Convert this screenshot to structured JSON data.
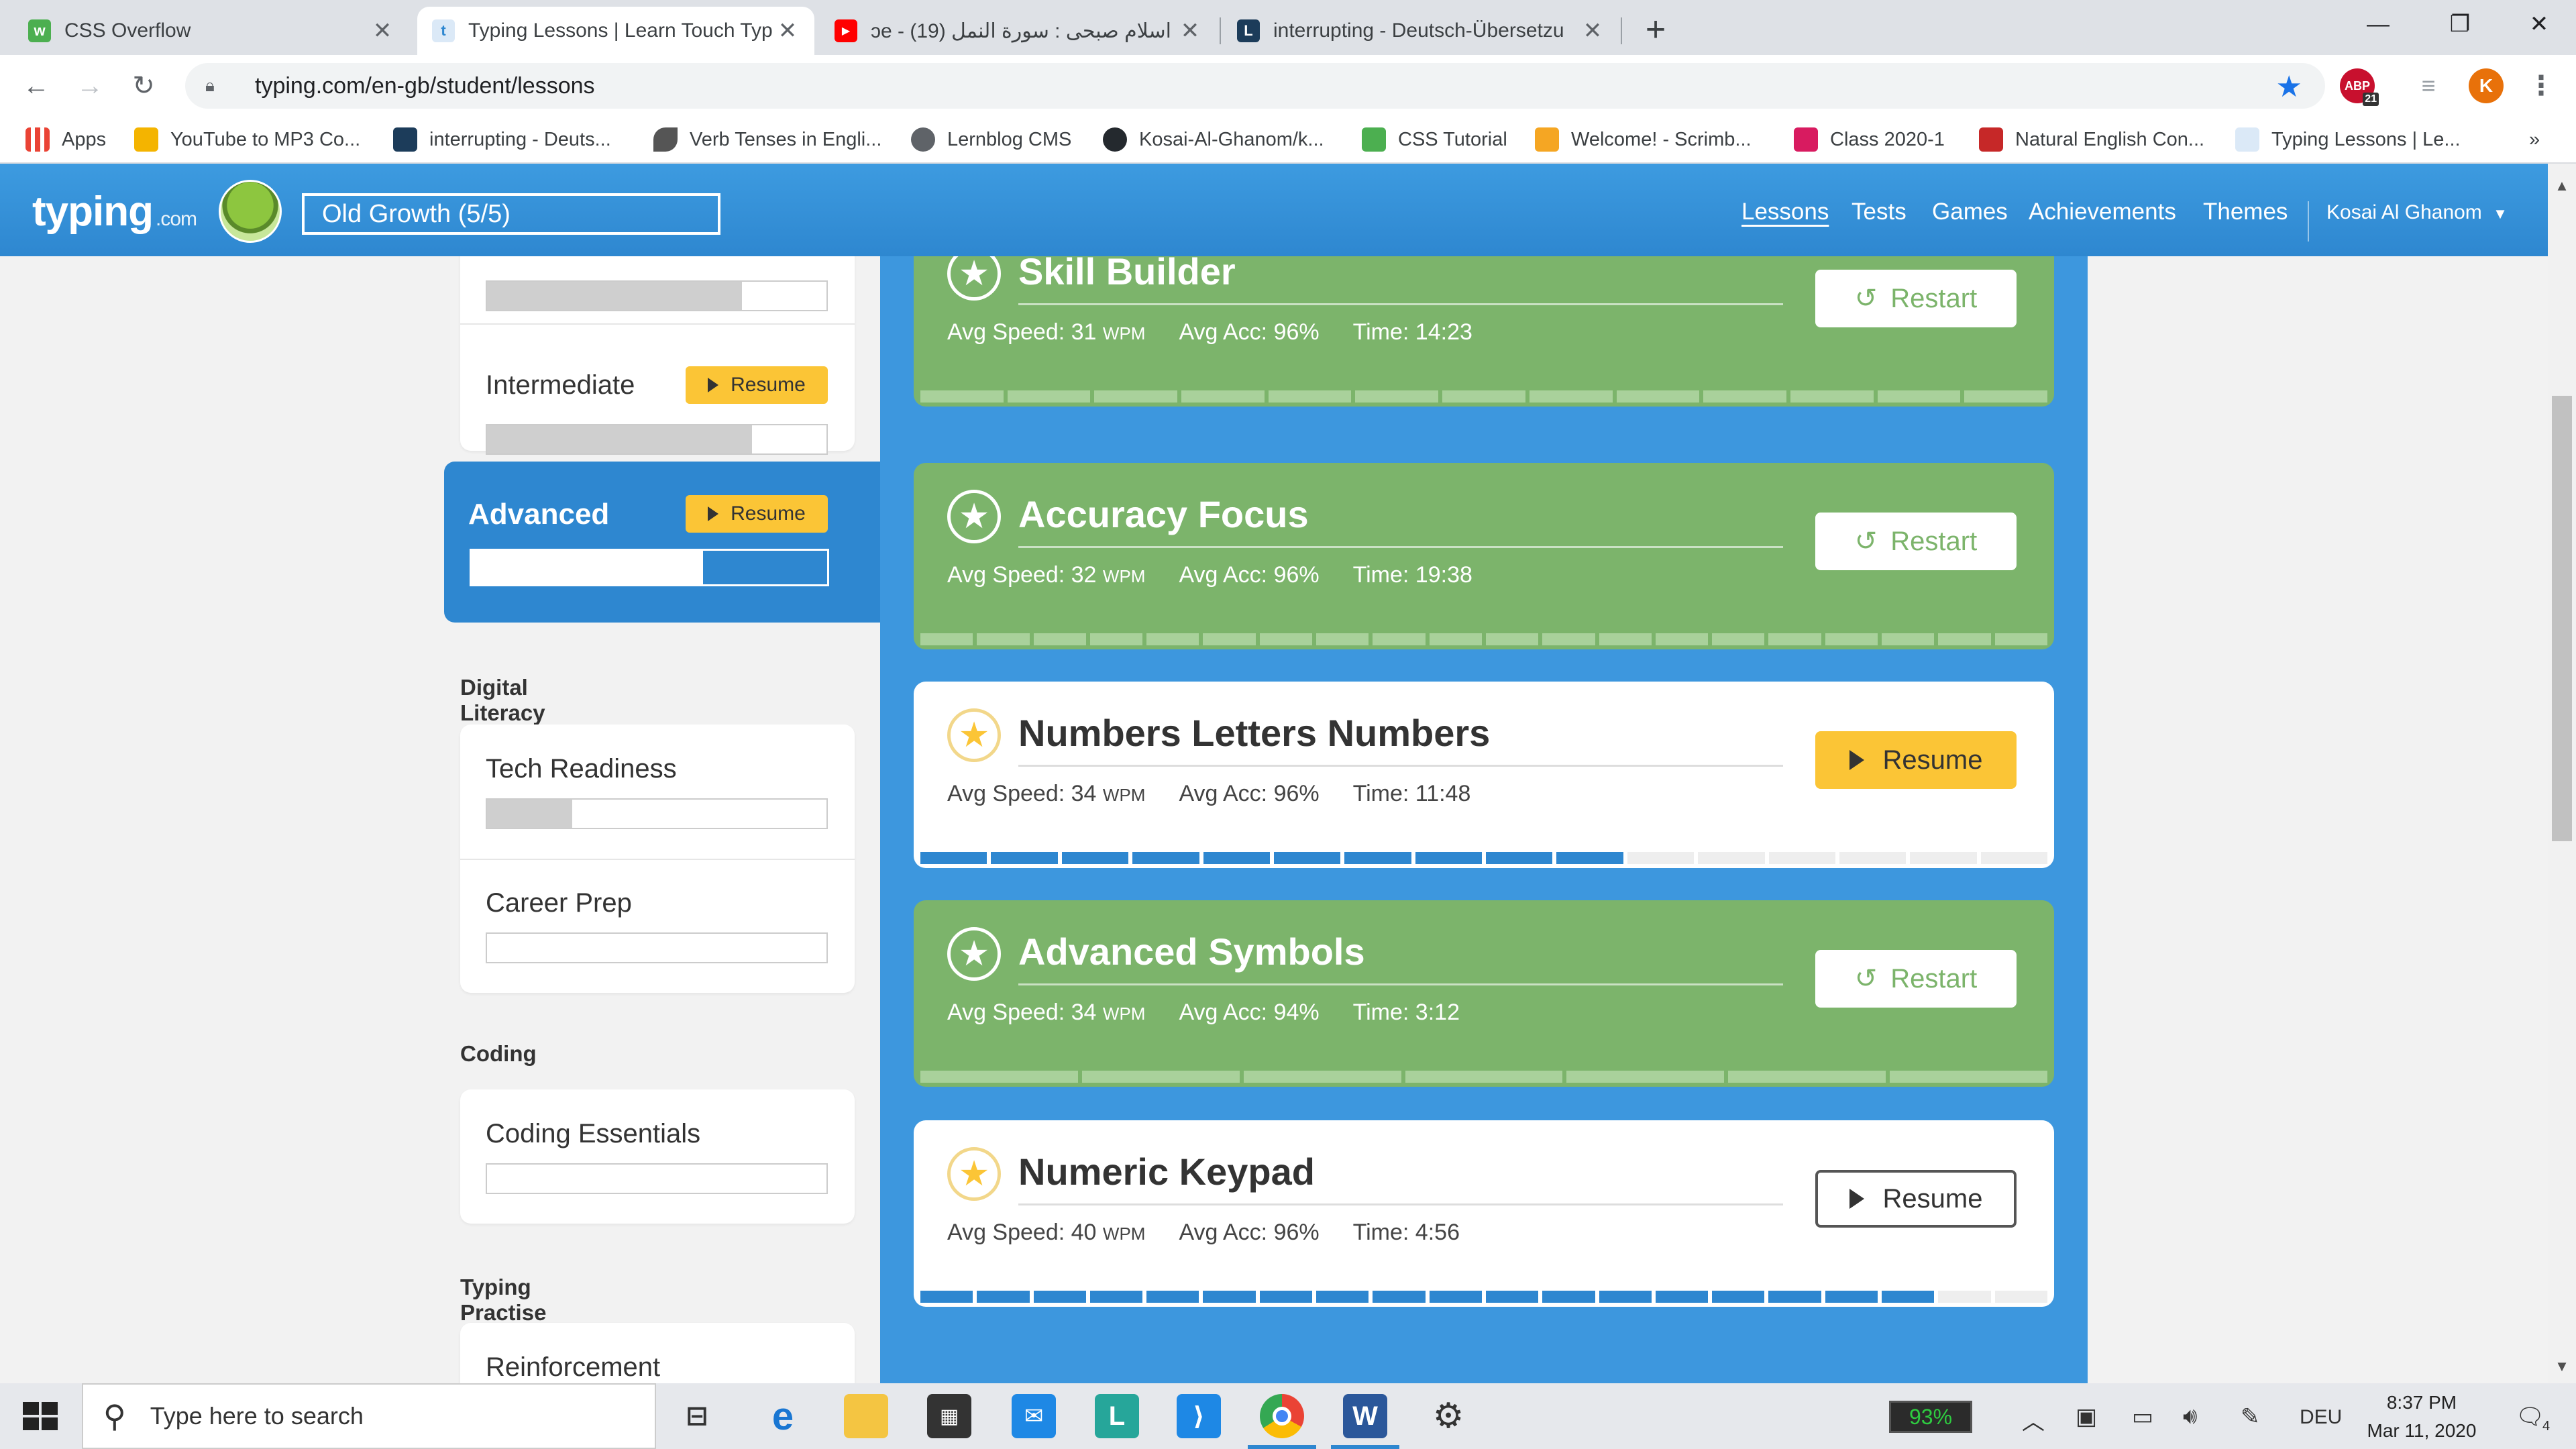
{
  "browser": {
    "tabs": [
      {
        "title": "CSS Overflow",
        "active": false
      },
      {
        "title": "Typing Lessons | Learn Touch Typ",
        "active": true
      },
      {
        "title": "ɔe - اسلام صبحى : سورة النمل (19)",
        "active": false
      },
      {
        "title": "interrupting - Deutsch-Übersetzu",
        "active": false
      }
    ],
    "url": "typing.com/en-gb/student/lessons",
    "profile_initial": "K",
    "ext_badge": "21",
    "bookmarks": [
      "Apps",
      "YouTube to MP3 Co...",
      "interrupting - Deuts...",
      "Verb Tenses in Engli...",
      "Lernblog CMS",
      "Kosai-Al-Ghanom/k...",
      "CSS Tutorial",
      "Welcome! - Scrimb...",
      "Class 2020-1",
      "Natural English Con...",
      "Typing Lessons | Le..."
    ],
    "bookmarks_more": "»"
  },
  "site": {
    "logo": "typing",
    "logo_suffix": ".com",
    "class_name": "Old Growth (5/5)",
    "nav": [
      "Lessons",
      "Tests",
      "Games",
      "Achievements",
      "Themes"
    ],
    "user": "Kosai Al Ghanom"
  },
  "sidebar": {
    "top_item_progress": 0.75,
    "intermediate": {
      "name": "Intermediate",
      "button": "Resume",
      "progress": 0.78
    },
    "advanced": {
      "name": "Advanced",
      "button": "Resume",
      "progress": 0.65
    },
    "sections": [
      {
        "title": "Digital Literacy",
        "items": [
          {
            "name": "Tech Readiness",
            "progress": 0.25
          },
          {
            "name": "Career Prep",
            "progress": 0
          }
        ]
      },
      {
        "title": "Coding",
        "items": [
          {
            "name": "Coding Essentials",
            "progress": 0
          }
        ]
      },
      {
        "title": "Typing Practise",
        "items": [
          {
            "name": "Reinforcement",
            "progress": 0
          }
        ]
      }
    ]
  },
  "lessons": [
    {
      "title": "Skill Builder",
      "speed": "Avg Speed: 31",
      "unit": "WPM",
      "acc": "Avg Acc: 96%",
      "time": "Time: 14:23",
      "status": "done",
      "button": "Restart",
      "segments": 13,
      "completed": 13
    },
    {
      "title": "Accuracy Focus",
      "speed": "Avg Speed: 32",
      "unit": "WPM",
      "acc": "Avg Acc: 96%",
      "time": "Time: 19:38",
      "status": "done",
      "button": "Restart",
      "segments": 20,
      "completed": 20
    },
    {
      "title": "Numbers Letters Numbers",
      "speed": "Avg Speed: 34",
      "unit": "WPM",
      "acc": "Avg Acc: 96%",
      "time": "Time: 11:48",
      "status": "open",
      "button": "Resume",
      "segments": 16,
      "completed": 10
    },
    {
      "title": "Advanced Symbols",
      "speed": "Avg Speed: 34",
      "unit": "WPM",
      "acc": "Avg Acc: 94%",
      "time": "Time: 3:12",
      "status": "done",
      "button": "Restart",
      "segments": 7,
      "completed": 7
    },
    {
      "title": "Numeric Keypad",
      "speed": "Avg Speed: 40",
      "unit": "WPM",
      "acc": "Avg Acc: 96%",
      "time": "Time: 4:56",
      "status": "open",
      "button": "Resume",
      "segments": 20,
      "completed": 18
    }
  ],
  "taskbar": {
    "search_placeholder": "Type here to search",
    "battery": "93%",
    "language": "DEU",
    "time": "8:37 PM",
    "date": "Mar 11, 2020",
    "notifications": "4"
  },
  "colors": {
    "site_blue": "#2e87d0",
    "lesson_green": "#7cb46b",
    "resume_yellow": "#fbc536"
  }
}
